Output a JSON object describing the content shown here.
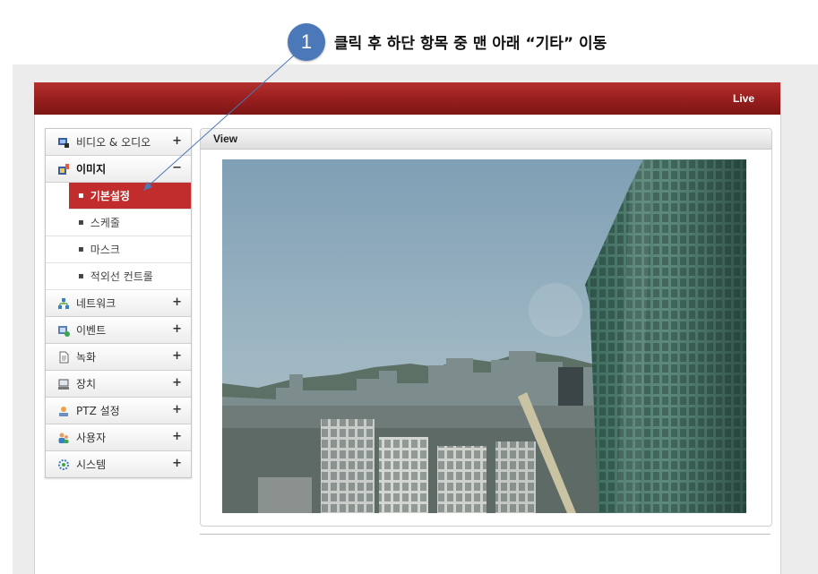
{
  "callout": {
    "number": "1",
    "text": "클릭 후 하단 항목 중 맨 아래 “기타” 이동"
  },
  "topbar": {
    "live_label": "Live"
  },
  "sidebar": {
    "items": [
      {
        "label": "비디오 & 오디오",
        "sign": "+",
        "icon": "video-audio-icon"
      },
      {
        "label": "이미지",
        "sign": "−",
        "icon": "image-icon"
      },
      {
        "label": "네트워크",
        "sign": "+",
        "icon": "network-icon"
      },
      {
        "label": "이벤트",
        "sign": "+",
        "icon": "event-icon"
      },
      {
        "label": "녹화",
        "sign": "+",
        "icon": "record-icon"
      },
      {
        "label": "장치",
        "sign": "+",
        "icon": "device-icon"
      },
      {
        "label": "PTZ 설정",
        "sign": "+",
        "icon": "ptz-icon"
      },
      {
        "label": "사용자",
        "sign": "+",
        "icon": "user-icon"
      },
      {
        "label": "시스템",
        "sign": "+",
        "icon": "system-icon"
      }
    ],
    "image_sub": [
      {
        "label": "기본설정",
        "active": true
      },
      {
        "label": "스케줄"
      },
      {
        "label": "마스크"
      },
      {
        "label": "적외선 컨트롤"
      }
    ],
    "bullet": "▪"
  },
  "content": {
    "title": "View"
  },
  "colors": {
    "accent_red": "#b3302f",
    "active_red": "#c12c2c",
    "callout_blue": "#4a78b8"
  }
}
